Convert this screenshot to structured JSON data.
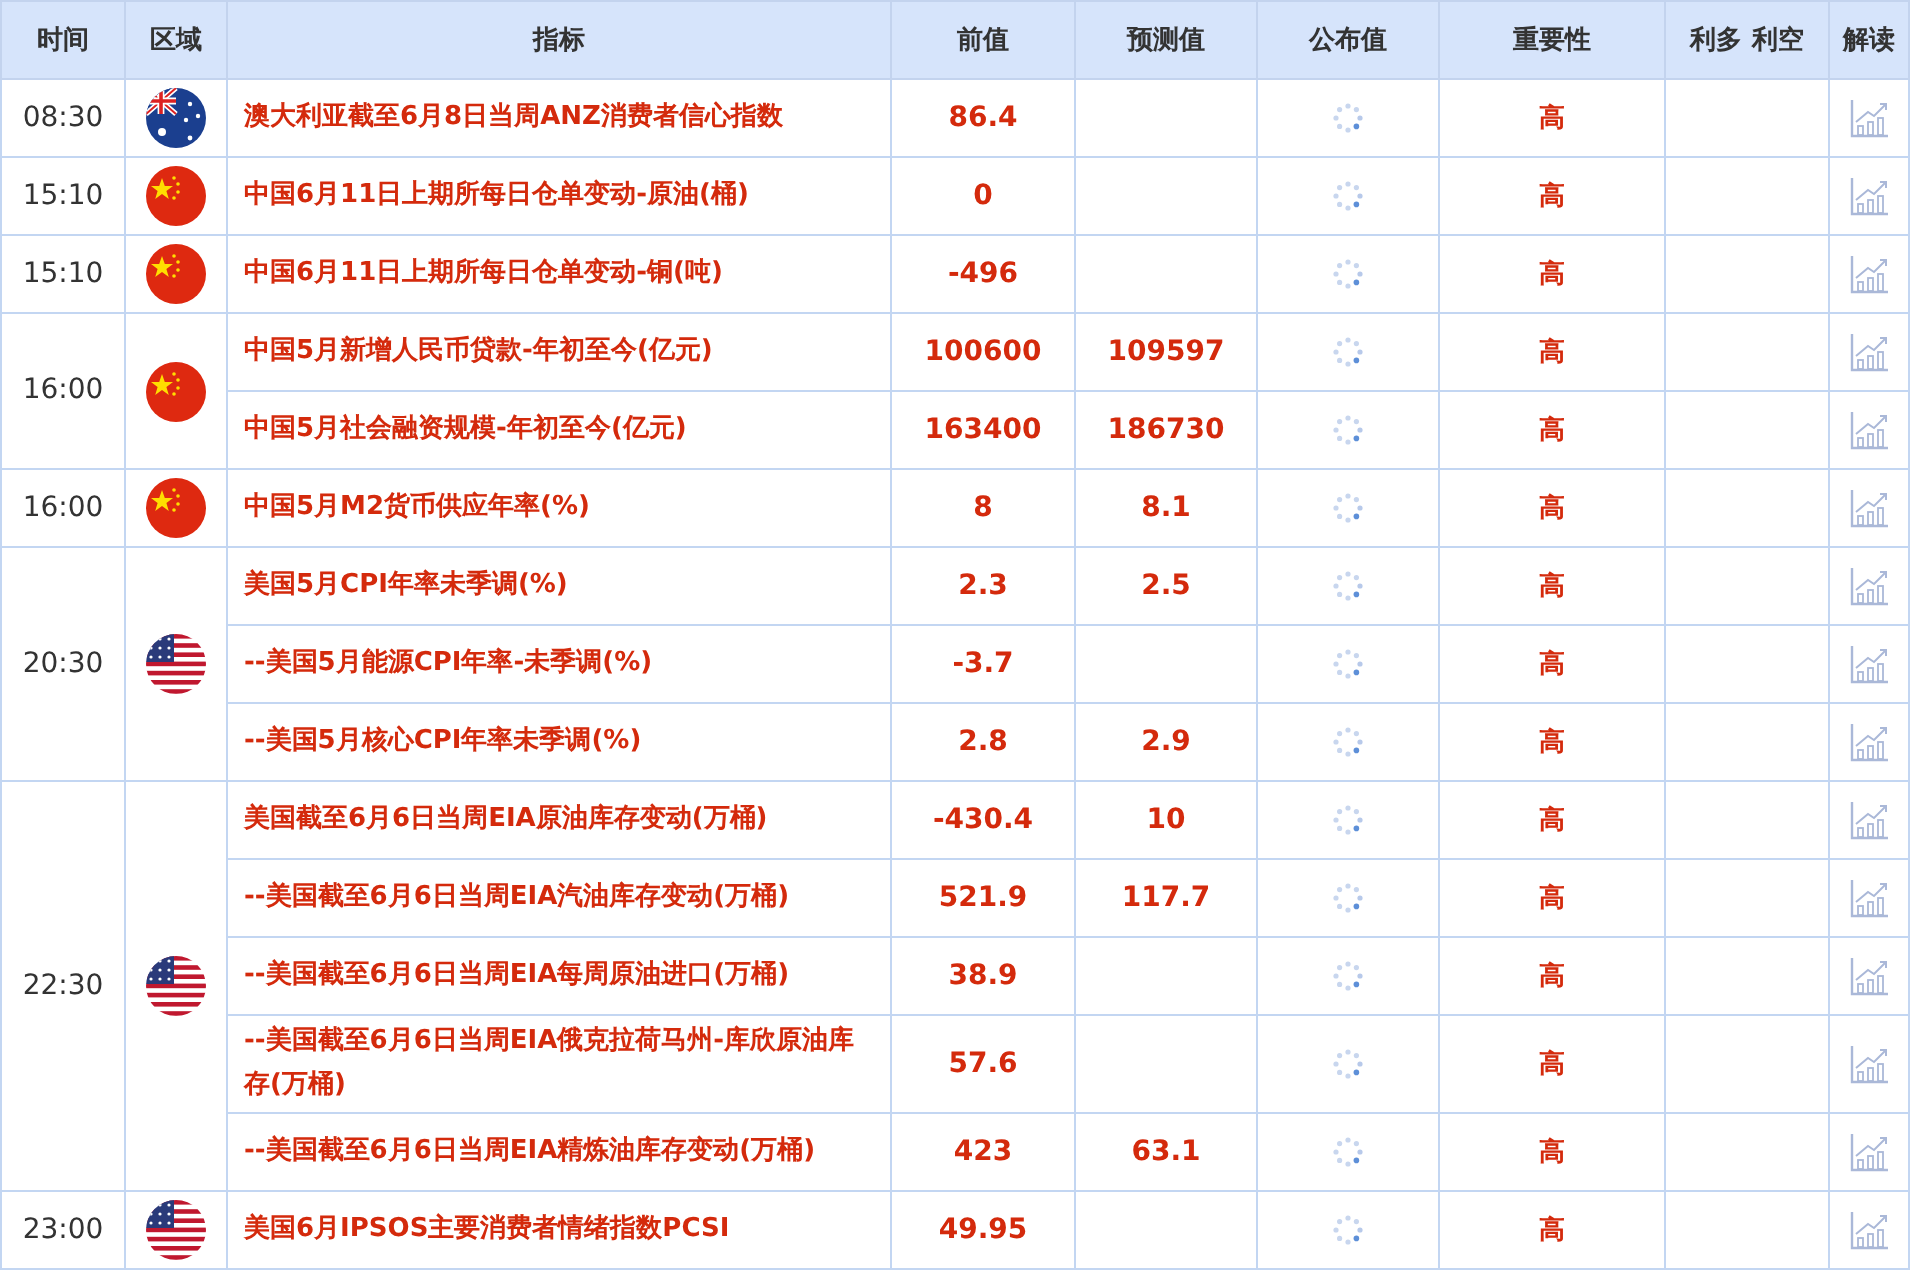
{
  "columns": [
    "时间",
    "区域",
    "指标",
    "前值",
    "预测值",
    "公布值",
    "重要性",
    "利多 利空",
    "解读"
  ],
  "groups": [
    {
      "time": "08:30",
      "kind": "au",
      "events": [
        {
          "name": "澳大利亚截至6月8日当周ANZ消费者信心指数",
          "previous": "86.4",
          "importance": "高"
        }
      ]
    },
    {
      "time": "15:10",
      "kind": "cn",
      "events": [
        {
          "name": "中国6月11日上期所每日仓单变动-原油(桶)",
          "previous": "0",
          "importance": "高"
        }
      ]
    },
    {
      "time": "15:10",
      "kind": "cn",
      "events": [
        {
          "name": "中国6月11日上期所每日仓单变动-铜(吨)",
          "previous": "-496",
          "importance": "高"
        }
      ]
    },
    {
      "time": "16:00",
      "kind": "cn",
      "events": [
        {
          "name": "中国5月新增人民币贷款-年初至今(亿元)",
          "previous": "100600",
          "forecast": "109597",
          "importance": "高"
        },
        {
          "name": "中国5月社会融资规模-年初至今(亿元)",
          "previous": "163400",
          "forecast": "186730",
          "importance": "高"
        }
      ]
    },
    {
      "time": "16:00",
      "kind": "cn",
      "events": [
        {
          "name": "中国5月M2货币供应年率(%)",
          "previous": "8",
          "forecast": "8.1",
          "importance": "高"
        }
      ]
    },
    {
      "time": "20:30",
      "kind": "us",
      "events": [
        {
          "name": "美国5月CPI年率未季调(%)",
          "previous": "2.3",
          "forecast": "2.5",
          "importance": "高"
        },
        {
          "name": "--美国5月能源CPI年率-未季调(%)",
          "previous": "-3.7",
          "importance": "高"
        },
        {
          "name": "--美国5月核心CPI年率未季调(%)",
          "previous": "2.8",
          "forecast": "2.9",
          "importance": "高"
        }
      ]
    },
    {
      "time": "22:30",
      "kind": "us",
      "events": [
        {
          "name": "美国截至6月6日当周EIA原油库存变动(万桶)",
          "previous": "-430.4",
          "forecast": "10",
          "importance": "高"
        },
        {
          "name": "--美国截至6月6日当周EIA汽油库存变动(万桶)",
          "previous": "521.9",
          "forecast": "117.7",
          "importance": "高"
        },
        {
          "name": "--美国截至6月6日当周EIA每周原油进口(万桶)",
          "previous": "38.9",
          "importance": "高"
        },
        {
          "name": "--美国截至6月6日当周EIA俄克拉荷马州-库欣原油库存(万桶)",
          "previous": "57.6",
          "importance": "高"
        },
        {
          "name": "--美国截至6月6日当周EIA精炼油库存变动(万桶)",
          "previous": "423",
          "forecast": "63.1",
          "importance": "高"
        }
      ]
    },
    {
      "time": "23:00",
      "kind": "us",
      "events": [
        {
          "name": "美国6月IPSOS主要消费者情绪指数PCSI",
          "previous": "49.95",
          "importance": "高"
        }
      ]
    }
  ]
}
